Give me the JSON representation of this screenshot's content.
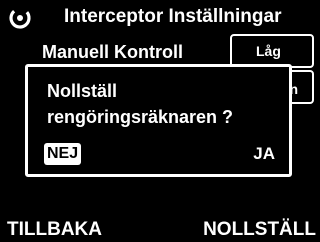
{
  "header": {
    "logo_icon": "brand-logo-icon",
    "title": "Interceptor Inställningar"
  },
  "background": {
    "row_label": "Manuell Kontroll",
    "value": "Låg",
    "second_box_text": "n"
  },
  "dialog": {
    "message_line1": "Nollställ",
    "message_line2": "rengöringsräknaren ?",
    "no_label": "NEJ",
    "yes_label": "JA",
    "selected": "NEJ"
  },
  "softkeys": {
    "left": "TILLBAKA",
    "right": "NOLLSTÄLL"
  },
  "colors": {
    "background": "#000000",
    "foreground": "#ffffff"
  }
}
